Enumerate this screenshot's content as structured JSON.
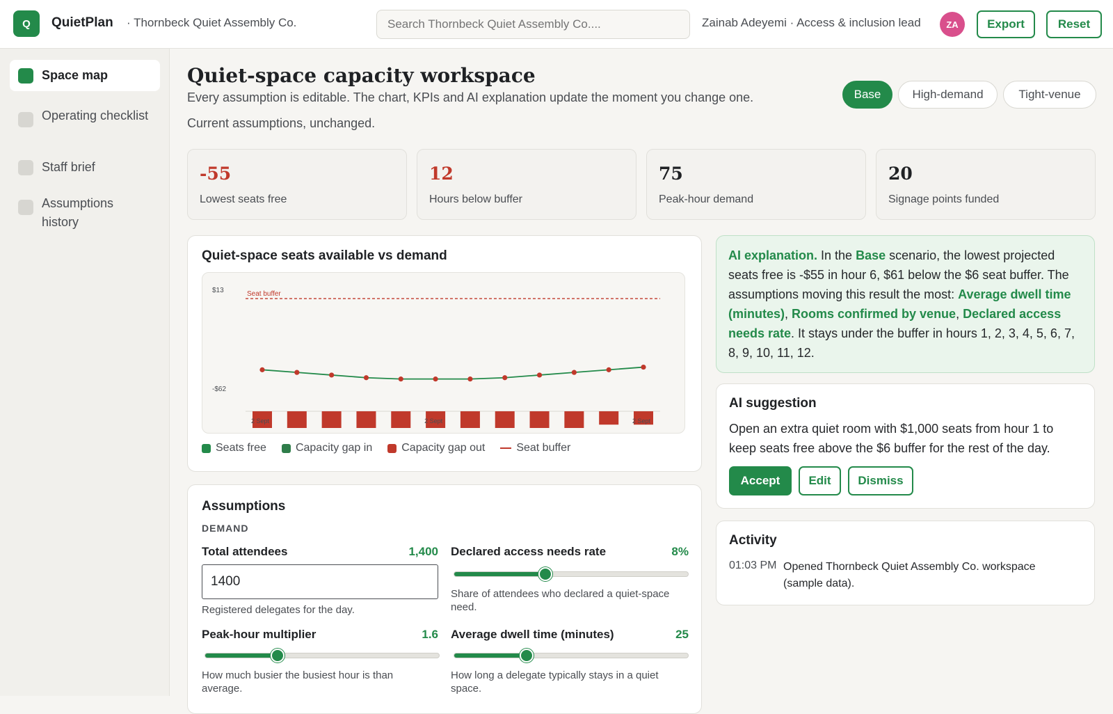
{
  "app": {
    "logo_letter": "Q",
    "name": "QuietPlan",
    "org": "· Thornbeck Quiet Assembly Co."
  },
  "search": {
    "placeholder": "Search Thornbeck Quiet Assembly Co...."
  },
  "user": {
    "label": "Zainab Adeyemi · Access & inclusion lead",
    "initials": "ZA"
  },
  "actions": {
    "export": "Export",
    "reset": "Reset"
  },
  "sidebar": {
    "items": [
      {
        "label": "Space map",
        "active": true
      },
      {
        "label": "Operating checklist"
      },
      {
        "label": "Staff brief"
      },
      {
        "label": "Assumptions history"
      }
    ]
  },
  "page": {
    "title": "Quiet-space capacity workspace",
    "subtitle": "Every assumption is editable. The chart, KPIs and AI explanation update the moment you change one.",
    "status": "Current assumptions, unchanged."
  },
  "scenarios": [
    "Base",
    "High-demand",
    "Tight-venue"
  ],
  "kpis": [
    {
      "value": "-55",
      "label": "Lowest seats free",
      "color": "#c0392b"
    },
    {
      "value": "12",
      "label": "Hours below buffer",
      "color": "#c0392b"
    },
    {
      "value": "75",
      "label": "Peak-hour demand",
      "color": "#1f2124"
    },
    {
      "value": "20",
      "label": "Signage points funded",
      "color": "#1f2124"
    }
  ],
  "chart_card": {
    "title": "Quiet-space seats available vs demand"
  },
  "chart_data": {
    "type": "line",
    "title": "Quiet-space seats available vs demand",
    "y_ticks": [
      "$13",
      "-$62"
    ],
    "buffer_label": "Seat buffer",
    "x_tick_labels": [
      "2 Sept",
      "2 Sept",
      "2 Sept"
    ],
    "x": [
      1,
      2,
      3,
      4,
      5,
      6,
      7,
      8,
      9,
      10,
      11,
      12
    ],
    "series": [
      {
        "name": "Seats free",
        "color": "#238a4a",
        "values": [
          -48,
          -50,
          -52,
          -54,
          -55,
          -55,
          -55,
          -54,
          -52,
          -50,
          -48,
          -46
        ]
      },
      {
        "name": "Capacity gap in",
        "color": "#238a4a",
        "values": []
      },
      {
        "name": "Capacity gap out",
        "color": "#c0392b",
        "values": [
          1,
          1,
          1,
          1,
          1,
          1,
          1,
          1,
          1,
          1,
          0.8,
          0.8
        ]
      }
    ],
    "buffer": {
      "name": "Seat buffer",
      "value": 6
    },
    "ylim": [
      -80,
      15
    ],
    "legend": [
      "Seats free",
      "Capacity gap in",
      "Capacity gap out",
      "Seat buffer"
    ]
  },
  "ai_explanation": {
    "lead": "AI explanation.",
    "t1": " In the ",
    "scenario": "Base",
    "t2": " scenario, the lowest projected seats free is -$55 in hour 6, $61 below the $6 seat buffer. The assumptions moving this result the most: ",
    "a1": "Average dwell time (minutes)",
    "sep1": ", ",
    "a2": "Rooms confirmed by venue",
    "sep2": ", ",
    "a3": "Declared access needs rate",
    "t3": ". It stays under the buffer in hours 1, 2, 3, 4, 5, 6, 7, 8, 9, 10, 11, 12."
  },
  "suggestion": {
    "title": "AI suggestion",
    "text": "Open an extra quiet room with $1,000 seats from hour 1 to keep seats free above the $6 buffer for the rest of the day.",
    "accept": "Accept",
    "edit": "Edit",
    "dismiss": "Dismiss"
  },
  "activity": {
    "title": "Activity",
    "time": "01:03 PM",
    "text": "Opened Thornbeck Quiet Assembly Co. workspace (sample data)."
  },
  "assumptions": {
    "title": "Assumptions",
    "section": "DEMAND",
    "fields": {
      "total_attendees": {
        "label": "Total attendees",
        "value": "1,400",
        "input": "1400",
        "help": "Registered delegates for the day."
      },
      "access_rate": {
        "label": "Declared access needs rate",
        "value": "8%",
        "level": 0.39,
        "help": "Share of attendees who declared a quiet-space need."
      },
      "peak_multiplier": {
        "label": "Peak-hour multiplier",
        "value": "1.6",
        "level": 0.31,
        "help": "How much busier the busiest hour is than average."
      },
      "dwell_time": {
        "label": "Average dwell time (minutes)",
        "value": "25",
        "level": 0.31,
        "help": "How long a delegate typically stays in a quiet space."
      }
    }
  }
}
